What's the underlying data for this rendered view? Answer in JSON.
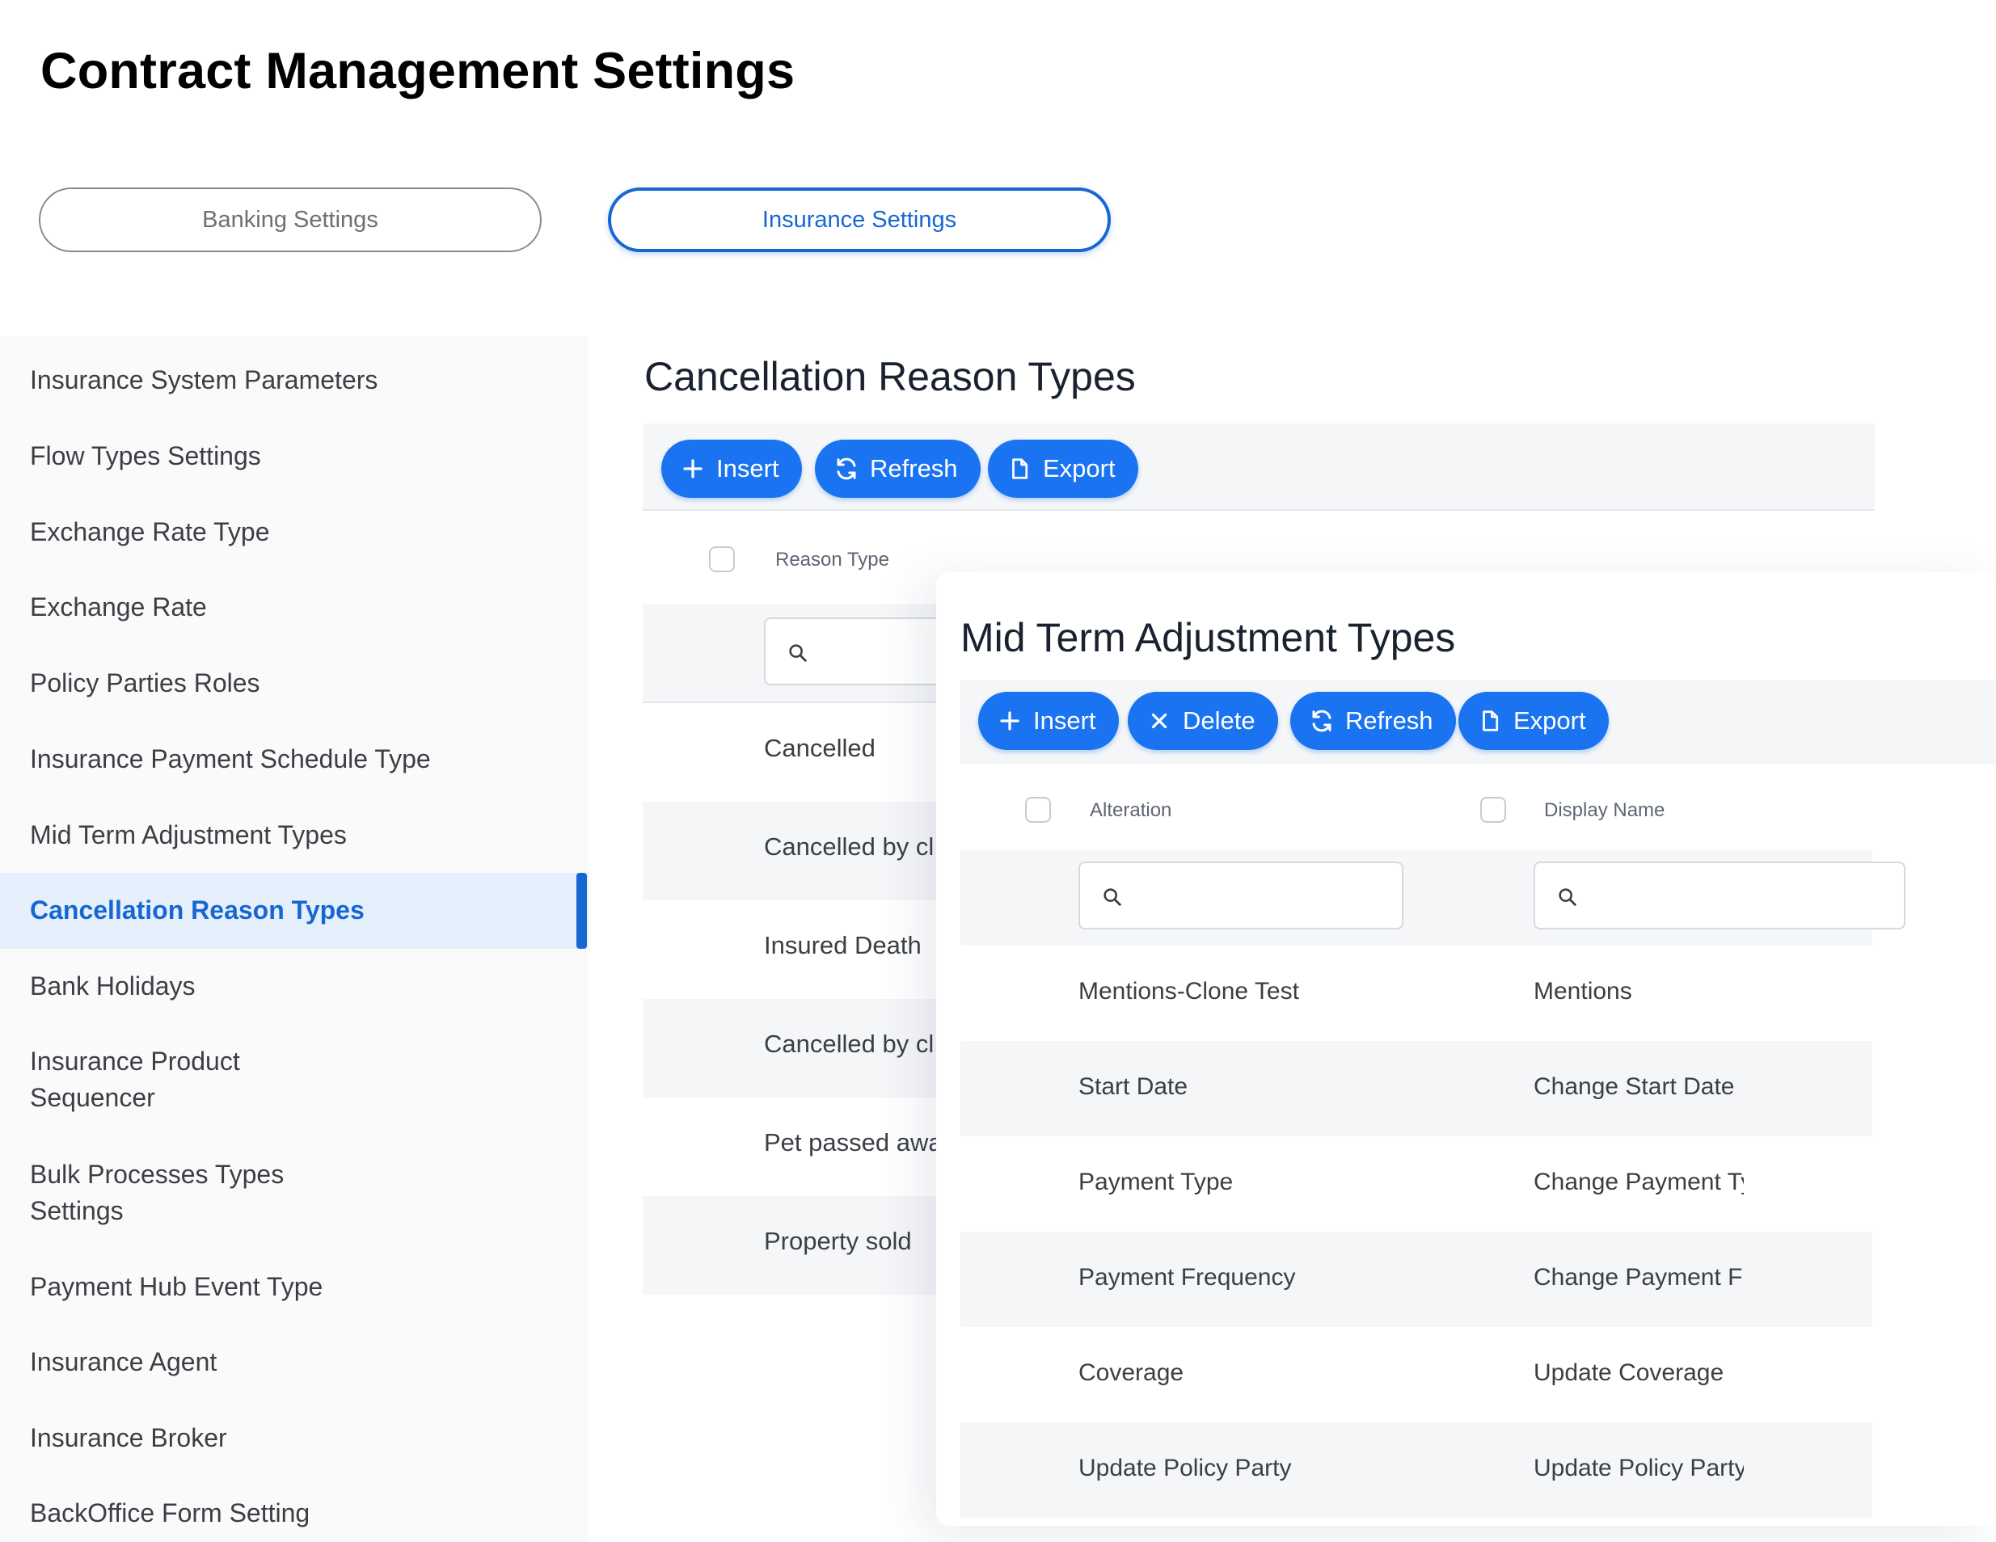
{
  "page": {
    "title": "Contract Management Settings"
  },
  "tabs": {
    "banking": "Banking Settings",
    "insurance": "Insurance Settings"
  },
  "sidebar": {
    "items": [
      "Insurance System Parameters",
      "Flow Types Settings",
      "Exchange Rate Type",
      "Exchange Rate",
      "Policy Parties Roles",
      "Insurance Payment Schedule Type",
      "Mid Term Adjustment Types",
      "Cancellation Reason Types",
      "Bank Holidays",
      "Insurance Product Sequencer",
      "Bulk Processes Types Settings",
      "Payment Hub Event Type",
      "Insurance Agent",
      "Insurance Broker",
      "BackOffice Form Setting"
    ],
    "selected": "Cancellation Reason Types"
  },
  "cancellation": {
    "title": "Cancellation Reason Types",
    "toolbar": {
      "insert": "Insert",
      "refresh": "Refresh",
      "export": "Export"
    },
    "column": "Reason Type",
    "rows": [
      "Cancelled",
      "Cancelled by cl",
      "Insured Death",
      "Cancelled by cl",
      "Pet passed awa",
      "Property sold"
    ]
  },
  "midterm": {
    "title": "Mid Term Adjustment Types",
    "toolbar": {
      "insert": "Insert",
      "delete": "Delete",
      "refresh": "Refresh",
      "export": "Export"
    },
    "columns": {
      "alteration": "Alteration",
      "display_name": "Display Name"
    },
    "rows": [
      {
        "alteration": "Mentions-Clone Test",
        "display_name": "Mentions"
      },
      {
        "alteration": "Start Date",
        "display_name": "Change Start Date"
      },
      {
        "alteration": "Payment Type",
        "display_name": "Change Payment Type"
      },
      {
        "alteration": "Payment Frequency",
        "display_name": "Change Payment Frequency"
      },
      {
        "alteration": "Coverage",
        "display_name": "Update Coverage"
      },
      {
        "alteration": "Update Policy Party",
        "display_name": "Update Policy Party"
      }
    ]
  },
  "colors": {
    "accent": "#1a73f0",
    "selected_text": "#1767d2",
    "selected_bg": "#e6f0fd",
    "stripe": "#f5f6f8"
  },
  "icons": [
    "plus-icon",
    "refresh-icon",
    "file-icon",
    "close-icon",
    "search-icon"
  ]
}
